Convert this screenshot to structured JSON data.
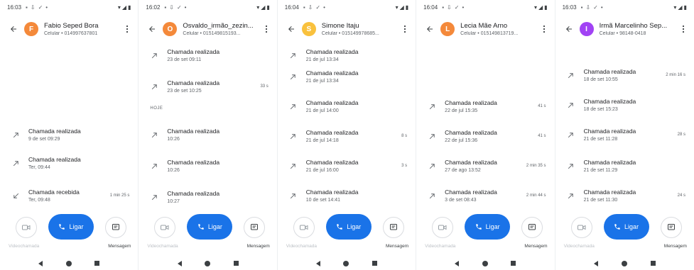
{
  "phones": [
    {
      "status_time": "16:03",
      "contact": {
        "name": "Fabio Seped Bora",
        "subtitle": "Celular • 014997637801",
        "avatar_letter": "F",
        "avatar_color": "#f4893a"
      },
      "calls": [
        {
          "title": "Chamada realizada",
          "date": "9 de set 09:29",
          "duration": "",
          "type": "outgoing"
        },
        {
          "title": "Chamada realizada",
          "date": "Ter, 09:44",
          "duration": "",
          "type": "outgoing"
        },
        {
          "title": "Chamada recebida",
          "date": "Ter, 09:48",
          "duration": "1 min 25 s",
          "type": "incoming"
        }
      ],
      "section_label": ""
    },
    {
      "status_time": "16:02",
      "contact": {
        "name": "Osvaldo_irmão_zezin...",
        "subtitle": "Celular • 015149815193...",
        "avatar_letter": "O",
        "avatar_color": "#f4893a"
      },
      "calls": [
        {
          "title": "Chamada realizada",
          "date": "23 de set 09:11",
          "duration": "",
          "type": "outgoing"
        },
        {
          "title": "Chamada realizada",
          "date": "23 de set 10:25",
          "duration": "33 s",
          "type": "outgoing"
        },
        {
          "title": "Chamada realizada",
          "date": "10:26",
          "duration": "",
          "type": "outgoing"
        },
        {
          "title": "Chamada realizada",
          "date": "10:26",
          "duration": "",
          "type": "outgoing"
        },
        {
          "title": "Chamada realizada",
          "date": "10:27",
          "duration": "",
          "type": "outgoing"
        }
      ],
      "section_label": "HOJE"
    },
    {
      "status_time": "16:04",
      "contact": {
        "name": "Simone Itaju",
        "subtitle": "Celular • 015149978685...",
        "avatar_letter": "S",
        "avatar_color": "#f9c13d"
      },
      "calls": [
        {
          "title": "Chamada realizada",
          "date": "21 de jul 13:34",
          "duration": "",
          "type": "outgoing"
        },
        {
          "title": "Chamada realizada",
          "date": "21 de jul 13:34",
          "duration": "",
          "type": "outgoing"
        },
        {
          "title": "Chamada realizada",
          "date": "21 de jul 14:00",
          "duration": "",
          "type": "outgoing"
        },
        {
          "title": "Chamada realizada",
          "date": "21 de jul 14:18",
          "duration": "8 s",
          "type": "outgoing"
        },
        {
          "title": "Chamada realizada",
          "date": "21 de jul 16:00",
          "duration": "3 s",
          "type": "outgoing"
        },
        {
          "title": "Chamada realizada",
          "date": "10 de set 14:41",
          "duration": "",
          "type": "outgoing"
        }
      ],
      "section_label": ""
    },
    {
      "status_time": "16:04",
      "contact": {
        "name": "Lecia Mãe Arno",
        "subtitle": "Celular • 015149813719...",
        "avatar_letter": "L",
        "avatar_color": "#f4893a"
      },
      "calls": [
        {
          "title": "Chamada realizada",
          "date": "22 de jul 15:35",
          "duration": "41 s",
          "type": "outgoing"
        },
        {
          "title": "Chamada realizada",
          "date": "22 de jul 15:36",
          "duration": "41 s",
          "type": "outgoing"
        },
        {
          "title": "Chamada realizada",
          "date": "27 de ago 13:52",
          "duration": "2 min 35 s",
          "type": "outgoing"
        },
        {
          "title": "Chamada realizada",
          "date": "3 de set 08:43",
          "duration": "2 min 44 s",
          "type": "outgoing"
        }
      ],
      "section_label": ""
    },
    {
      "status_time": "16:03",
      "contact": {
        "name": "Irmã Marcelinho Sep...",
        "subtitle": "Celular • 98148-0418",
        "avatar_letter": "I",
        "avatar_color": "#a142f4"
      },
      "calls": [
        {
          "title": "Chamada realizada",
          "date": "18 de set 10:55",
          "duration": "2 min 16 s",
          "type": "outgoing"
        },
        {
          "title": "Chamada realizada",
          "date": "18 de set 15:23",
          "duration": "",
          "type": "outgoing"
        },
        {
          "title": "Chamada realizada",
          "date": "21 de set 11:28",
          "duration": "28 s",
          "type": "outgoing"
        },
        {
          "title": "Chamada realizada",
          "date": "21 de set 11:29",
          "duration": "",
          "type": "outgoing"
        },
        {
          "title": "Chamada realizada",
          "date": "21 de set 11:30",
          "duration": "24 s",
          "type": "outgoing"
        }
      ],
      "section_label": ""
    }
  ],
  "actions": {
    "call_label": "Ligar",
    "video_label": "Videochamada",
    "message_label": "Mensagem"
  },
  "icons": {
    "back": "arrow-back-icon",
    "menu": "more-vert-icon",
    "outgoing": "call-made-icon",
    "incoming": "call-received-icon",
    "video": "videocam-icon",
    "phone": "phone-icon",
    "message": "message-icon"
  },
  "colors": {
    "primary": "#1a73e8"
  }
}
